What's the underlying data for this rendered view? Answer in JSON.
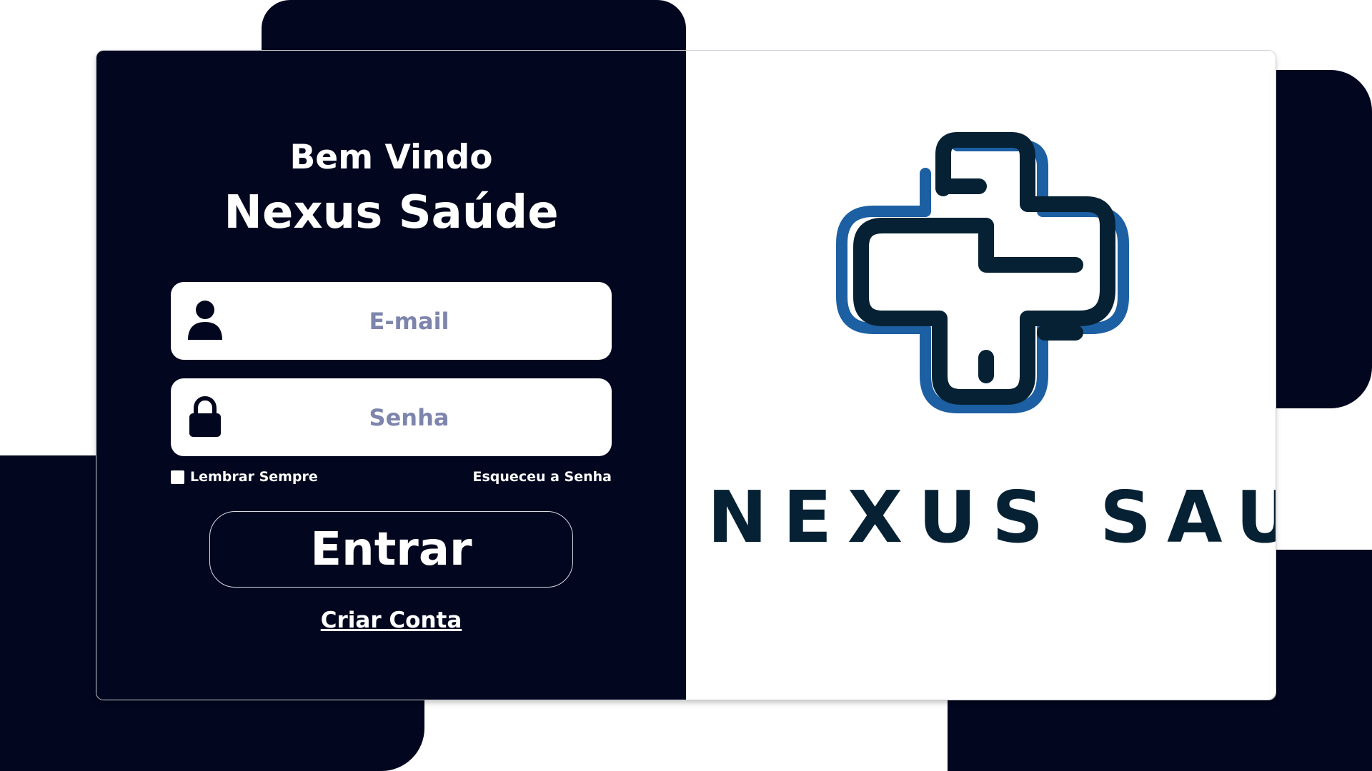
{
  "welcome": "Bem Vindo",
  "brand_title": "Nexus Saúde",
  "login": {
    "email_placeholder": "E-mail",
    "password_placeholder": "Senha",
    "remember_label": "Lembrar Sempre",
    "forgot_label": "Esqueceu a Senha",
    "submit_label": "Entrar",
    "create_account_label": "Criar Conta"
  },
  "logo": {
    "text": "NEXUS SAUDE",
    "icon": "medical-cross-icon",
    "primary_color": "#062133",
    "accent_color": "#1d5fa3"
  },
  "icons": {
    "email": "user-icon",
    "password": "lock-icon"
  },
  "colors": {
    "panel_dark": "#02061e",
    "placeholder": "#7e85ad"
  }
}
